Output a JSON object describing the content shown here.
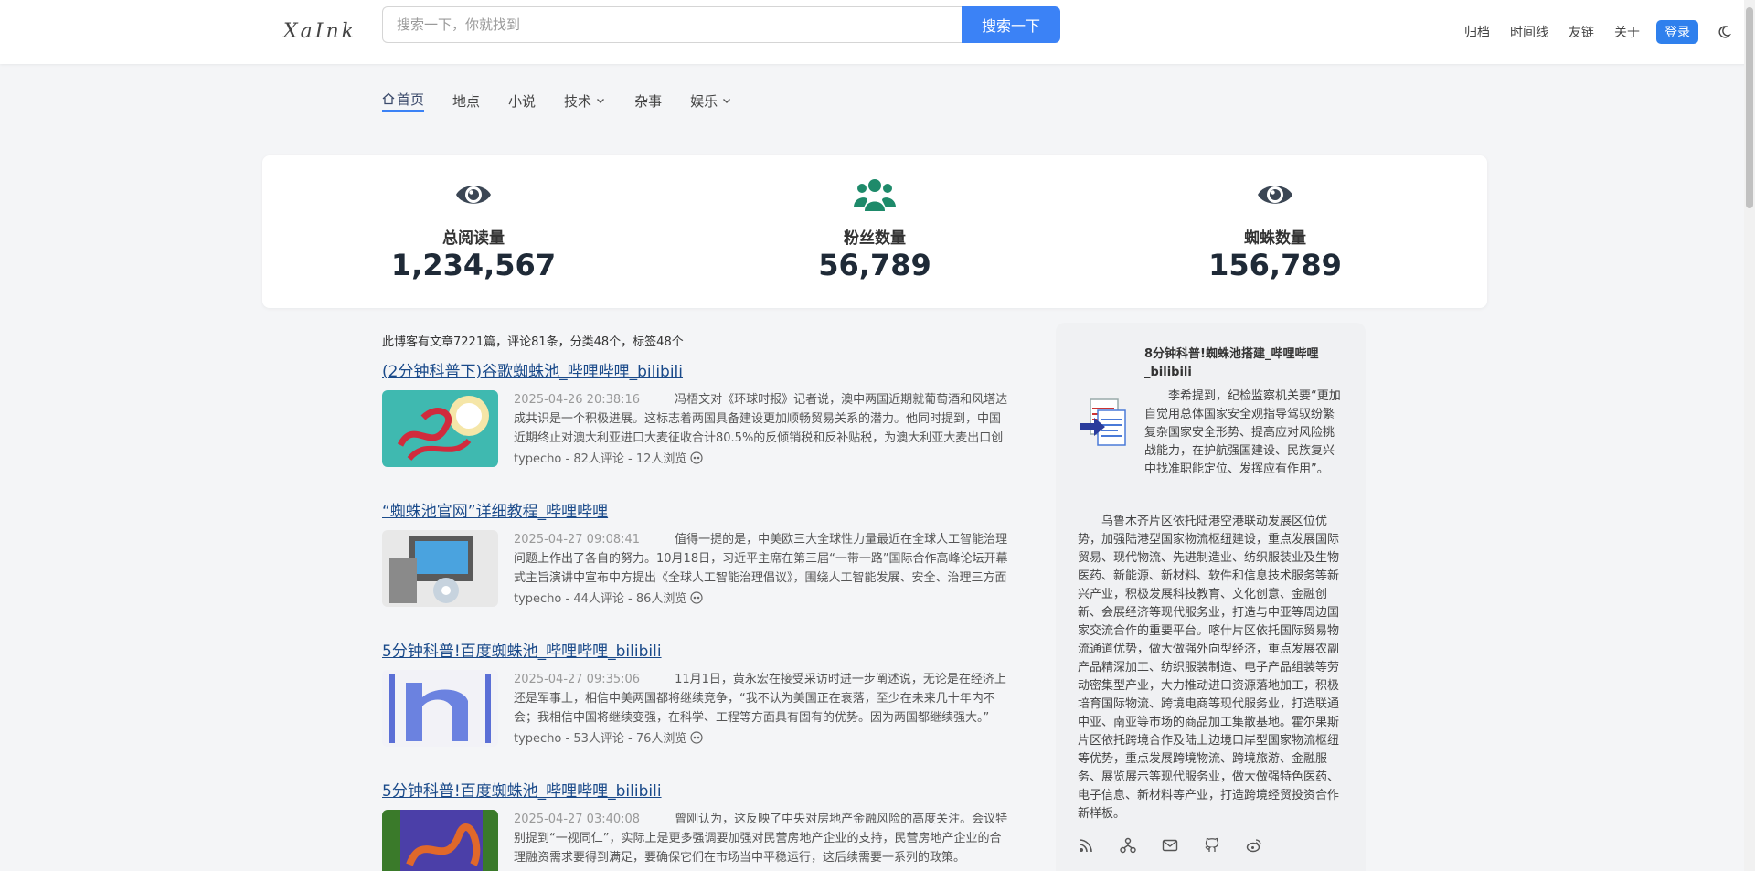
{
  "header": {
    "logo": "XaInk",
    "search_placeholder": "搜索一下，你就找到",
    "search_button": "搜索一下",
    "nav": [
      "归档",
      "时间线",
      "友链",
      "关于"
    ],
    "login": "登录"
  },
  "subnav": [
    {
      "label": "首页"
    },
    {
      "label": "地点"
    },
    {
      "label": "小说"
    },
    {
      "label": "技术"
    },
    {
      "label": "杂事"
    },
    {
      "label": "娱乐"
    }
  ],
  "stats": [
    {
      "label": "总阅读量",
      "value": "1,234,567",
      "icon": "eye-icon",
      "color": "#3b4654"
    },
    {
      "label": "粉丝数量",
      "value": "56,789",
      "icon": "users-icon",
      "color": "#1e8a6a"
    },
    {
      "label": "蜘蛛数量",
      "value": "156,789",
      "icon": "eye-icon",
      "color": "#3b4654"
    }
  ],
  "summary": "此博客有文章7221篇，评论81条，分类48个，标签48个",
  "posts": [
    {
      "title": "(2分钟科普下)谷歌蜘蛛池_哔哩哔哩_bilibili",
      "date": "2025-04-26 20:38:16",
      "excerpt": "冯梧文对《环球时报》记者说，澳中两国近期就葡萄酒和风塔达成共识是一个积极进展。这标志着两国具备建设更加顺畅贸易关系的潜力。他同时提到，中国近期终止对澳大利亚进口大麦征收合计80.5%的反倾销税和反补贴税，为澳大利亚大麦出口创造更好条件。",
      "meta": "typecho - 82人评论 - 12人浏览"
    },
    {
      "title": "“蜘蛛池官网”详细教程_哔哩哔哩",
      "date": "2025-04-27 09:08:41",
      "excerpt": "值得一提的是，中美欧三大全球性力量最近在全球人工智能治理问题上作出了各自的努力。10月18日，习近平主席在第三届“一带一路”国际合作高峰论坛开幕式主旨演讲中宣布中方提出《全球人工智能治理倡议》，围绕人工智能发展、安全、治理三方面系统阐述。",
      "meta": "typecho - 44人评论 - 86人浏览"
    },
    {
      "title": "5分钟科普!百度蜘蛛池_哔哩哔哩_bilibili",
      "date": "2025-04-27 09:35:06",
      "excerpt": "11月1日，黄永宏在接受采访时进一步阐述说，无论是在经济上还是军事上，相信中美两国都将继续竞争，“我不认为美国正在衰落，至少在未来几十年内不会；我相信中国将继续变强，在科学、工程等方面具有固有的优势。因为两国都继续强大。”",
      "meta": "typecho - 53人评论 - 76人浏览"
    },
    {
      "title": "5分钟科普!百度蜘蛛池_哔哩哔哩_bilibili",
      "date": "2025-04-27 03:40:08",
      "excerpt": "曾刚认为，这反映了中央对房地产金融风险的高度关注。会议特别提到“一视同仁”，实际上是更多强调要加强对民营房地产企业的支持，民营房地产企业的合理融资需求要得到满足，要确保它们在市场当中平稳运行，这后续需要一系列的政策。",
      "meta": ""
    }
  ],
  "sidebar": {
    "title": "8分钟科普!蜘蛛池搭建_哔哩哔哩_bilibili",
    "text": "李希提到，纪检监察机关要“更加自觉用总体国家安全观指导驾驭纷繁复杂国家安全形势、提高应对风险挑战能力，在护航强国建设、民族复兴中找准职能定位、发挥应有作用”。",
    "paragraph": "乌鲁木齐片区依托陆港空港联动发展区位优势，加强陆港型国家物流枢纽建设，重点发展国际贸易、现代物流、先进制造业、纺织服装业及生物医药、新能源、新材料、软件和信息技术服务等新兴产业，积极发展科技教育、文化创意、金融创新、会展经济等现代服务业，打造与中亚等周边国家交流合作的重要平台。喀什片区依托国际贸易物流通道优势，做大做强外向型经济，重点发展农副产品精深加工、纺织服装制造、电子产品组装等劳动密集型产业，大力推动进口资源落地加工，积极培育国际物流、跨境电商等现代服务业，打造联通中亚、南亚等市场的商品加工集散基地。霍尔果斯片区依托跨境合作及陆上边境口岸型国家物流枢纽等优势，重点发展跨境物流、跨境旅游、金融服务、展览展示等现代服务业，做大做强特色医药、电子信息、新材料等产业，打造跨境经贸投资合作新样板。"
  }
}
